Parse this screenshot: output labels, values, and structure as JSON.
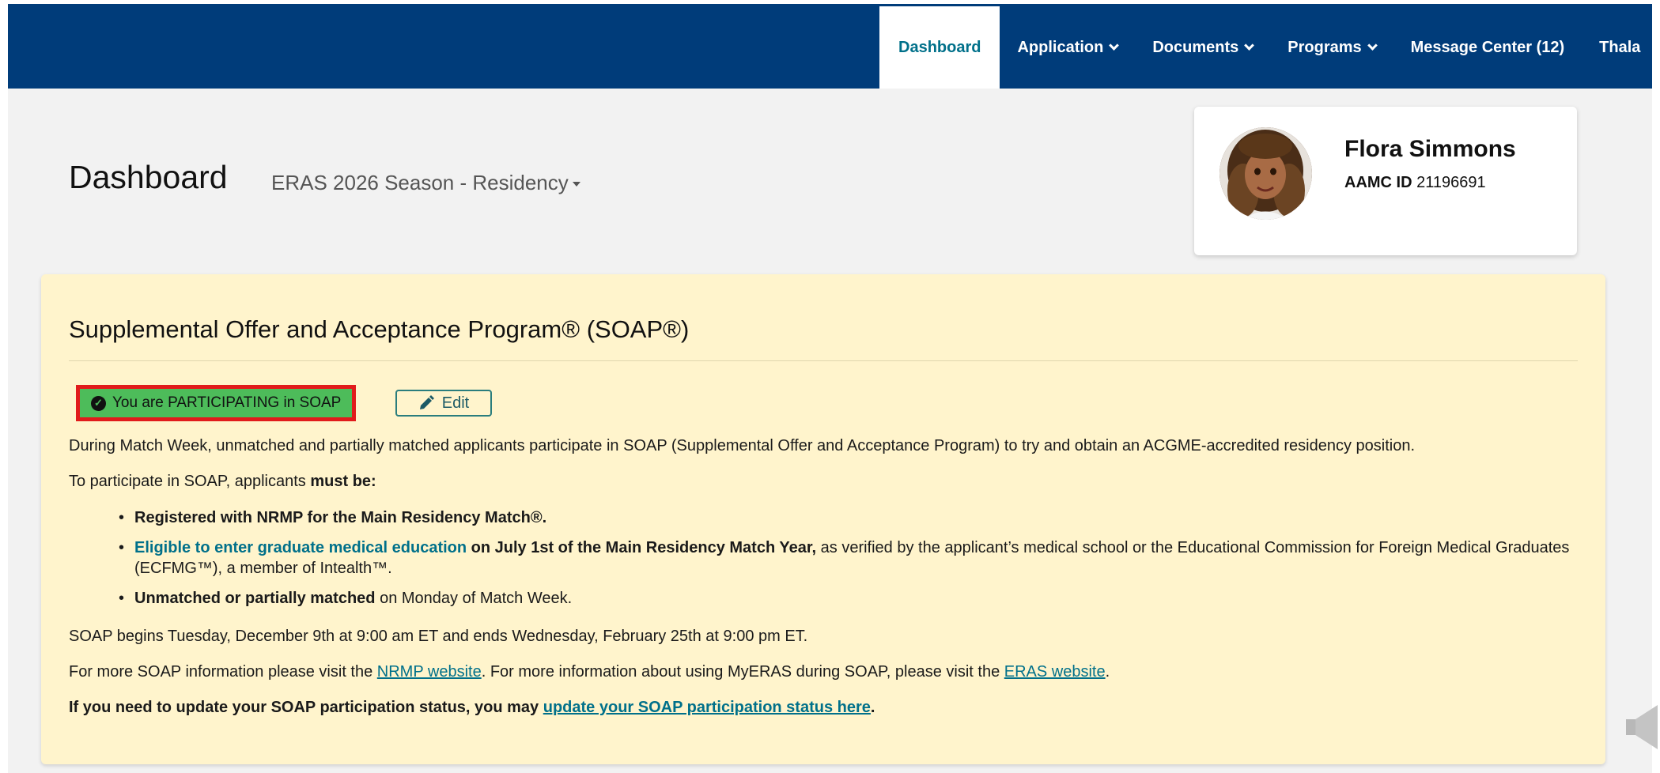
{
  "nav": {
    "items": [
      {
        "label": "Dashboard",
        "active": true,
        "dropdown": false
      },
      {
        "label": "Application",
        "active": false,
        "dropdown": true
      },
      {
        "label": "Documents",
        "active": false,
        "dropdown": true
      },
      {
        "label": "Programs",
        "active": false,
        "dropdown": true
      },
      {
        "label": "Message Center (12)",
        "active": false,
        "dropdown": false
      },
      {
        "label": "Thala",
        "active": false,
        "dropdown": false
      }
    ]
  },
  "header": {
    "title": "Dashboard",
    "season": "ERAS 2026 Season - Residency"
  },
  "profile": {
    "name": "Flora Simmons",
    "id_label": "AAMC ID",
    "id_value": "21196691"
  },
  "soap": {
    "title": "Supplemental Offer and Acceptance Program® (SOAP®)",
    "status": "You are PARTICIPATING in SOAP",
    "edit_label": "Edit",
    "intro": "During Match Week, unmatched and partially matched applicants participate in SOAP (Supplemental Offer and Acceptance Program) to try and obtain an ACGME-accredited residency position.",
    "requirements_lead": "To participate in SOAP, applicants ",
    "requirements_must": "must be:",
    "req1": "Registered with NRMP for the Main Residency Match®.",
    "req2_link": "Eligible to enter graduate medical education",
    "req2_bold": " on July 1st of the Main Residency Match Year,",
    "req2_rest": " as verified by the applicant’s medical school or the Educational Commission for Foreign Medical Graduates (ECFMG™), a member of Intealth™.",
    "req3_bold": "Unmatched or partially matched",
    "req3_rest": " on Monday of Match Week.",
    "dates": "SOAP begins Tuesday, December 9th at 9:00 am ET and ends Wednesday, February 25th at 9:00 pm ET.",
    "info_1": "For more SOAP information please visit the ",
    "info_nrmp_link": "NRMP website",
    "info_2": ". For more information about using MyERAS during SOAP, please visit the ",
    "info_eras_link": "ERAS website",
    "info_3": ".",
    "update_lead": "If you need to update your SOAP participation status, you may ",
    "update_link": "update your SOAP participation status here",
    "update_end": "."
  },
  "colors": {
    "navbar": "#003c7a",
    "accent": "#00708a",
    "panel": "#fff4cc",
    "participating": "#4dbc5a",
    "highlight_border": "#e11b1b"
  },
  "icons": {
    "status": "check-circle-icon",
    "edit": "pencil-icon",
    "speaker": "speaker-icon"
  }
}
